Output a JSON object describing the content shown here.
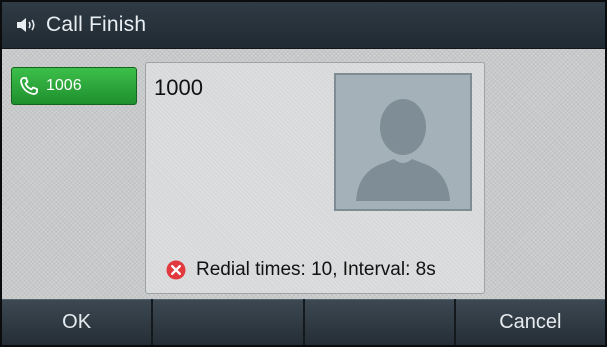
{
  "title_bar": {
    "icon": "speaker-icon",
    "title": "Call Finish"
  },
  "line_key": {
    "icon": "phone-handset-icon",
    "label": "1006",
    "color": "#2aa63a"
  },
  "call": {
    "number": "1000",
    "avatar_icon": "person-silhouette-icon",
    "status_icon": "error-x-icon",
    "status_text": "Redial times: 10, Interval: 8s"
  },
  "softkeys": [
    {
      "label": "OK"
    },
    {
      "label": ""
    },
    {
      "label": ""
    },
    {
      "label": "Cancel"
    }
  ],
  "colors": {
    "title_bar": "#26313a",
    "line_key_active": "#2aa63a",
    "error": "#e0393e"
  }
}
